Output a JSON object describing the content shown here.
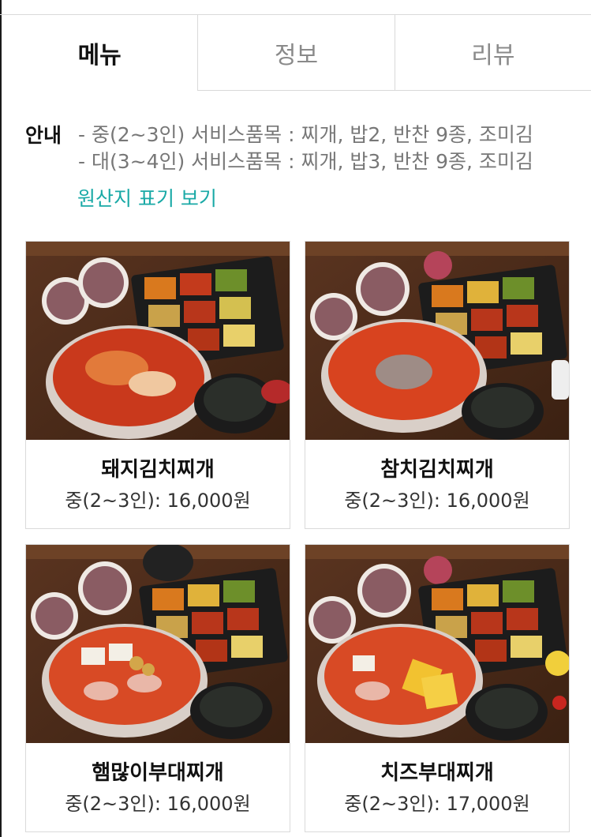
{
  "tabs": [
    {
      "label": "메뉴",
      "active": true
    },
    {
      "label": "정보",
      "active": false
    },
    {
      "label": "리뷰",
      "active": false
    }
  ],
  "info": {
    "label": "안내",
    "lines": [
      "- 중(2~3인) 서비스품목 : 찌개, 밥2, 반찬 9종, 조미김",
      "- 대(3~4인) 서비스품목 : 찌개, 밥3, 반찬 9종, 조미김"
    ],
    "origin_link": "원산지 표기 보기"
  },
  "menu": [
    {
      "name": "돼지김치찌개",
      "price": "중(2~3인): 16,000원"
    },
    {
      "name": "참치김치찌개",
      "price": "중(2~3인): 16,000원"
    },
    {
      "name": "햄많이부대찌개",
      "price": "중(2~3인): 16,000원"
    },
    {
      "name": "치즈부대찌개",
      "price": "중(2~3인): 17,000원"
    }
  ],
  "colors": {
    "accent": "#19a9a6",
    "border": "#dadada"
  }
}
